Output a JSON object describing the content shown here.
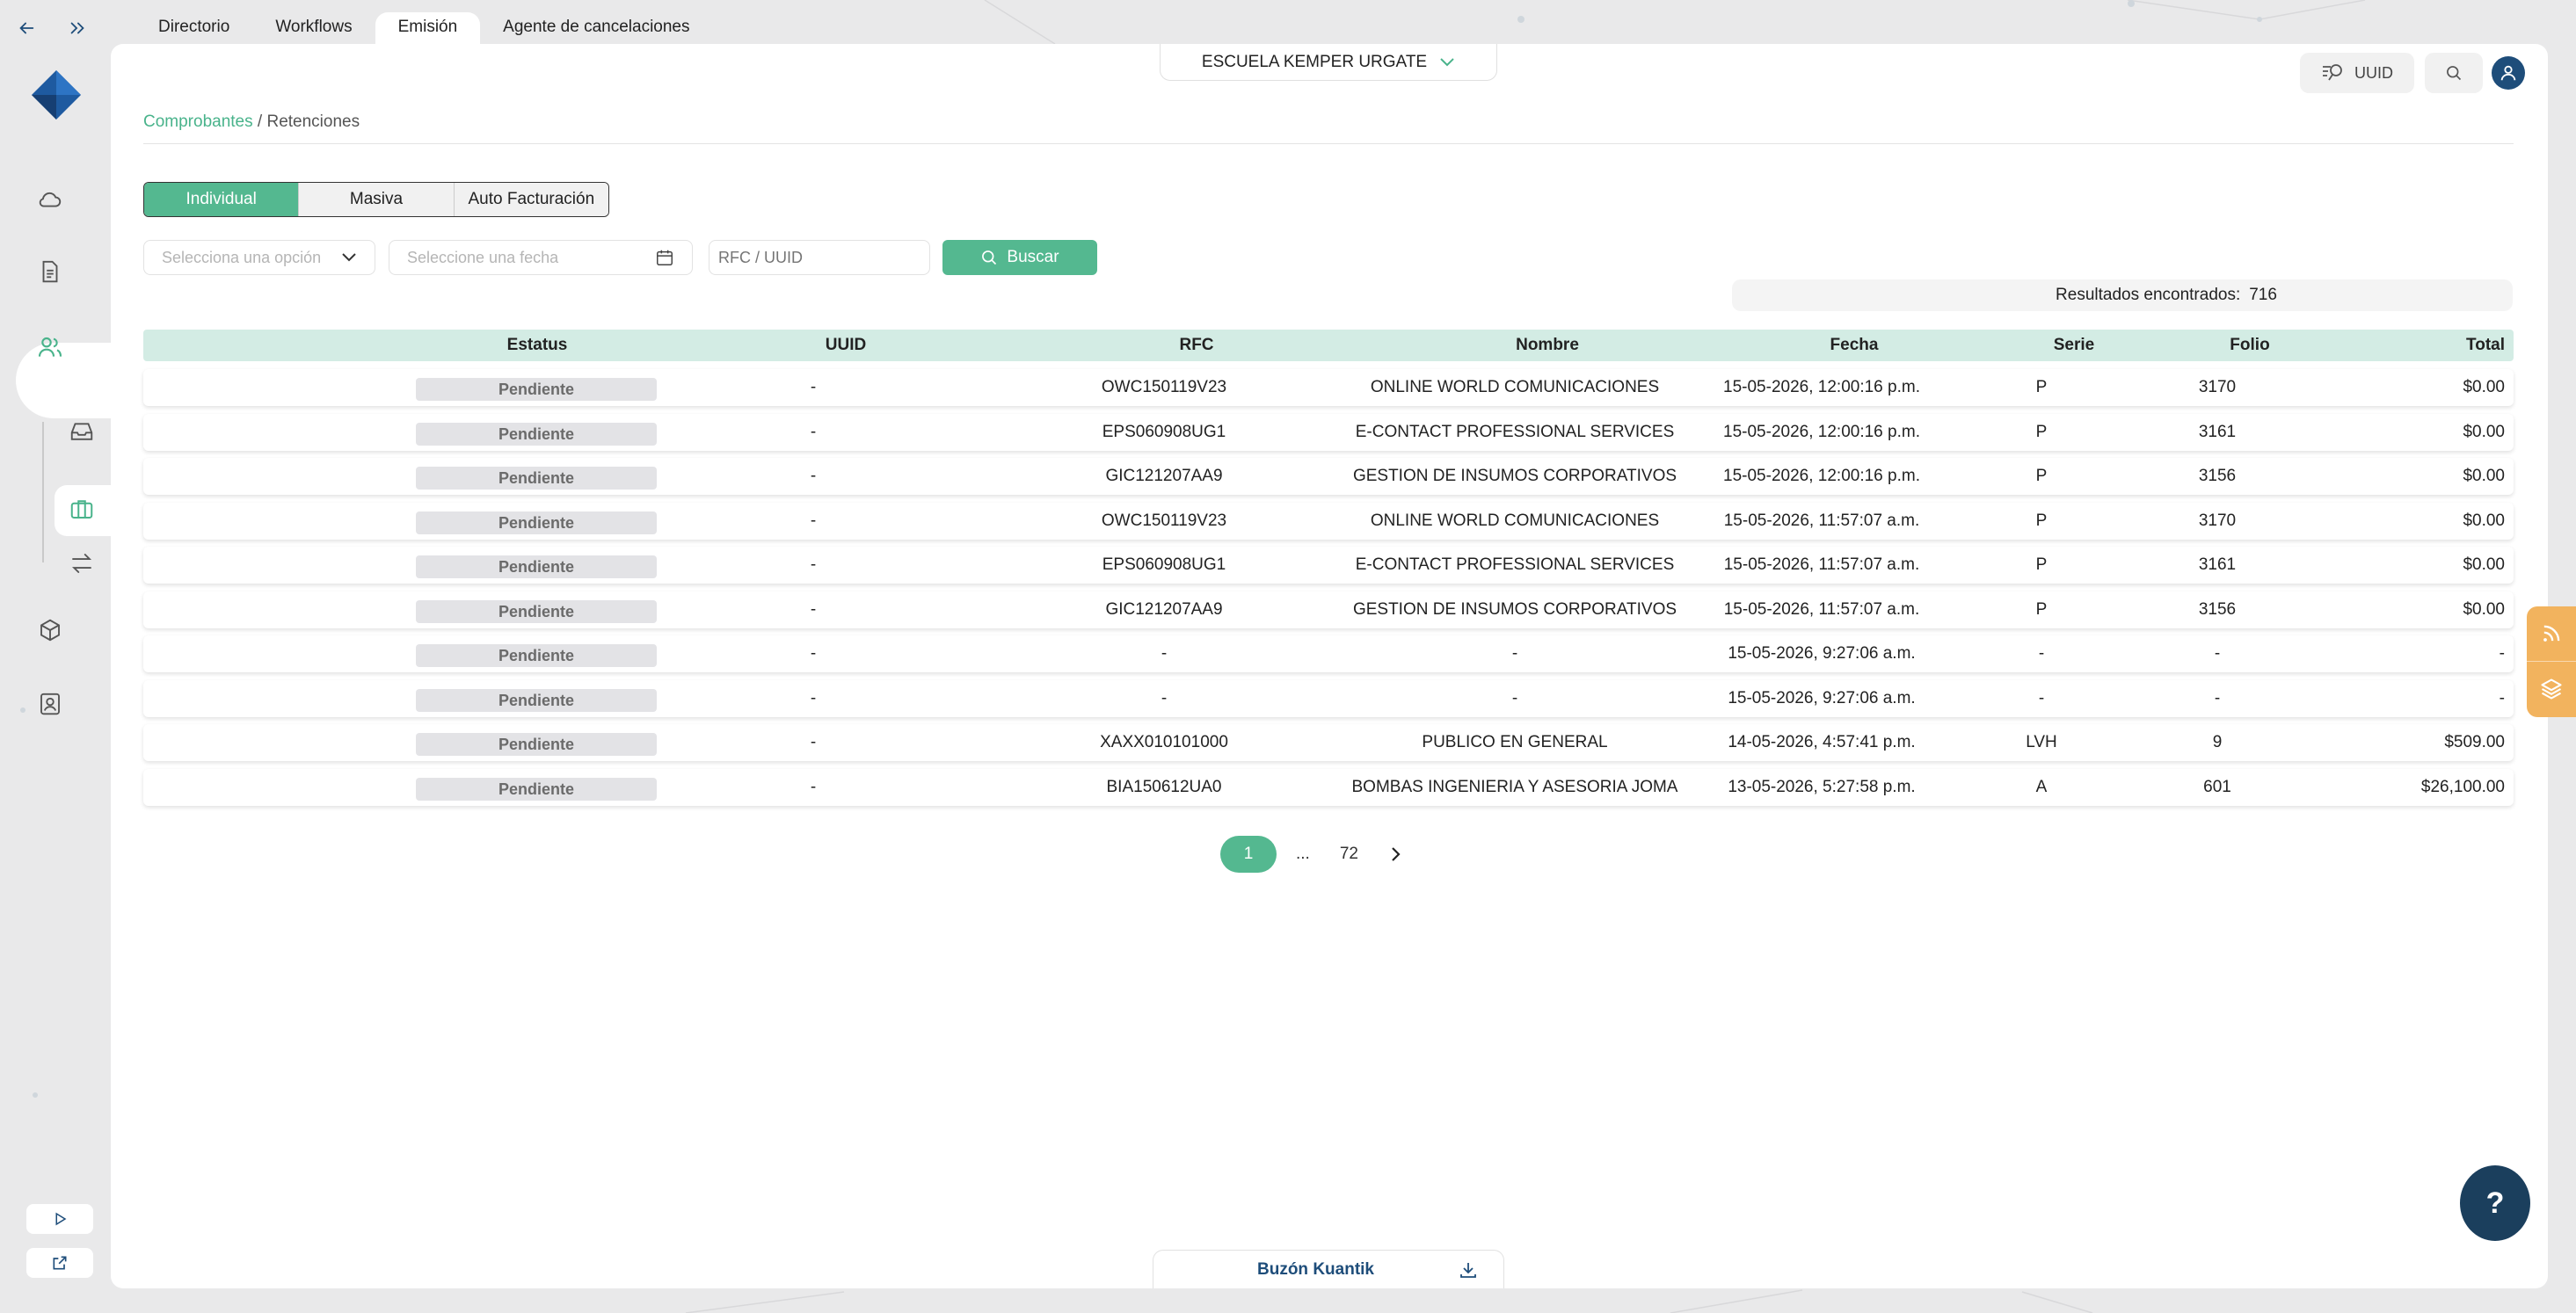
{
  "top_tabs": [
    {
      "label": "Directorio"
    },
    {
      "label": "Workflows"
    },
    {
      "label": "Emisión"
    },
    {
      "label": "Agente de cancelaciones"
    }
  ],
  "active_tab": "Emisión",
  "company": {
    "name": "ESCUELA KEMPER URGATE"
  },
  "header": {
    "uuid_label": "UUID"
  },
  "breadcrumb": {
    "link": "Comprobantes",
    "separator": " / ",
    "current": "Retenciones"
  },
  "segments": [
    {
      "label": "Individual"
    },
    {
      "label": "Masiva"
    },
    {
      "label": "Auto Facturación"
    }
  ],
  "filters": {
    "select_placeholder": "Selecciona una opción",
    "date_placeholder": "Seleccione una fecha",
    "rfc_placeholder": "RFC / UUID",
    "search_label": "Buscar"
  },
  "results": {
    "label": "Resultados encontrados:",
    "count": "716"
  },
  "table": {
    "columns": [
      "Estatus",
      "UUID",
      "RFC",
      "Nombre",
      "Fecha",
      "Serie",
      "Folio",
      "Total"
    ],
    "rows": [
      {
        "estatus": "Pendiente",
        "uuid": "-",
        "rfc": "OWC150119V23",
        "nombre": "ONLINE WORLD COMUNICACIONES",
        "fecha": "15-05-2026, 12:00:16 p.m.",
        "serie": "P",
        "folio": "3170",
        "total": "$0.00"
      },
      {
        "estatus": "Pendiente",
        "uuid": "-",
        "rfc": "EPS060908UG1",
        "nombre": "E-CONTACT PROFESSIONAL SERVICES",
        "fecha": "15-05-2026, 12:00:16 p.m.",
        "serie": "P",
        "folio": "3161",
        "total": "$0.00"
      },
      {
        "estatus": "Pendiente",
        "uuid": "-",
        "rfc": "GIC121207AA9",
        "nombre": "GESTION DE INSUMOS CORPORATIVOS",
        "fecha": "15-05-2026, 12:00:16 p.m.",
        "serie": "P",
        "folio": "3156",
        "total": "$0.00"
      },
      {
        "estatus": "Pendiente",
        "uuid": "-",
        "rfc": "OWC150119V23",
        "nombre": "ONLINE WORLD COMUNICACIONES",
        "fecha": "15-05-2026, 11:57:07 a.m.",
        "serie": "P",
        "folio": "3170",
        "total": "$0.00"
      },
      {
        "estatus": "Pendiente",
        "uuid": "-",
        "rfc": "EPS060908UG1",
        "nombre": "E-CONTACT PROFESSIONAL SERVICES",
        "fecha": "15-05-2026, 11:57:07 a.m.",
        "serie": "P",
        "folio": "3161",
        "total": "$0.00"
      },
      {
        "estatus": "Pendiente",
        "uuid": "-",
        "rfc": "GIC121207AA9",
        "nombre": "GESTION DE INSUMOS CORPORATIVOS",
        "fecha": "15-05-2026, 11:57:07 a.m.",
        "serie": "P",
        "folio": "3156",
        "total": "$0.00"
      },
      {
        "estatus": "Pendiente",
        "uuid": "-",
        "rfc": "-",
        "nombre": "-",
        "fecha": "15-05-2026, 9:27:06 a.m.",
        "serie": "-",
        "folio": "-",
        "total": "-"
      },
      {
        "estatus": "Pendiente",
        "uuid": "-",
        "rfc": "-",
        "nombre": "-",
        "fecha": "15-05-2026, 9:27:06 a.m.",
        "serie": "-",
        "folio": "-",
        "total": "-"
      },
      {
        "estatus": "Pendiente",
        "uuid": "-",
        "rfc": "XAXX010101000",
        "nombre": "PUBLICO EN GENERAL",
        "fecha": "14-05-2026, 4:57:41 p.m.",
        "serie": "LVH",
        "folio": "9",
        "total": "$509.00"
      },
      {
        "estatus": "Pendiente",
        "uuid": "-",
        "rfc": "BIA150612UA0",
        "nombre": "BOMBAS INGENIERIA Y ASESORIA JOMA",
        "fecha": "13-05-2026, 5:27:58 p.m.",
        "serie": "A",
        "folio": "601",
        "total": "$26,100.00"
      }
    ]
  },
  "pagination": {
    "current": "1",
    "ellipsis": "...",
    "last": "72"
  },
  "footer": {
    "buzon_label": "Buzón Kuantik",
    "help_label": "?"
  },
  "colors": {
    "accent": "#54b890",
    "brand": "#1e4d7a",
    "header_bg": "#d3ece4",
    "side_tab": "#f2b35e"
  }
}
